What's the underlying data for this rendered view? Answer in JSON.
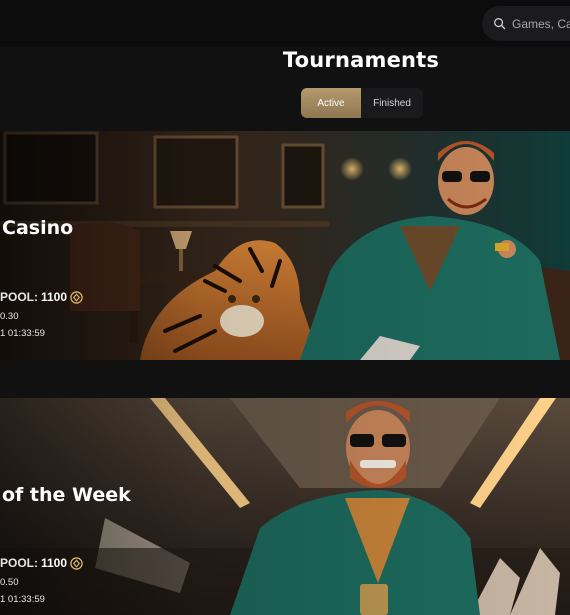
{
  "search": {
    "placeholder": "Games, Categories"
  },
  "page_title": "Tournaments",
  "tabs": [
    {
      "label": "Active",
      "active": true
    },
    {
      "label": "Finished",
      "active": false
    }
  ],
  "tournaments": [
    {
      "name": "Casino",
      "pool_label": "POOL:",
      "pool_value": "1100",
      "line1": "0.30",
      "line2": "1 01:33:59"
    },
    {
      "name": "of the Week",
      "pool_label": "POOL:",
      "pool_value": "1100",
      "line1": "0.50",
      "line2": "1 01:33:59"
    }
  ],
  "colors": {
    "accent_gold": "#b49a6c",
    "background": "#111112",
    "suit_teal": "#1d6b5e"
  },
  "icons": [
    "search-icon",
    "coin-icon"
  ]
}
